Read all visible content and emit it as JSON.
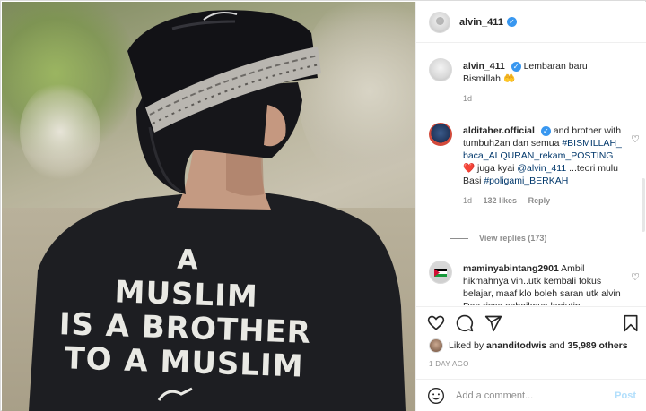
{
  "post": {
    "username": "alvin_411",
    "shirt_text": [
      "A",
      "MUSLIM",
      "IS A BROTHER",
      "TO A MUSLIM"
    ]
  },
  "caption": {
    "username": "alvin_411",
    "text": "Lembaran baru Bismillah",
    "emoji": "🤲",
    "time": "1d"
  },
  "comments": [
    {
      "username": "alditaher.official",
      "text_parts": [
        {
          "t": " and brother with tumbuh2an dan semua "
        },
        {
          "t": "#BISMILLAH_baca_ALQURAN_rekam_POSTING",
          "tag": true
        },
        {
          "t": "❤️"
        },
        {
          "t": " juga kyai "
        },
        {
          "t": "@alvin_411",
          "tag": true
        },
        {
          "t": " ...teori mulu Basi "
        },
        {
          "t": "#poligami_BERKAH",
          "tag": true
        }
      ],
      "time": "1d",
      "likes": "132 likes",
      "reply_label": "Reply",
      "view_replies": "View replies (173)"
    },
    {
      "username": "maminyabintang2901",
      "text": "Ambil hikmahnya vin..utk kembali fokus belajar, maaf klo boleh saran utk alvin Dan rissa sebaiknya lanjutin"
    }
  ],
  "likes": {
    "prefix": "Liked by ",
    "user": "ananditodwis",
    "and": " and ",
    "count": "35,989 others"
  },
  "time_ago": "1 DAY AGO",
  "add_comment": {
    "placeholder": "Add a comment...",
    "post_label": "Post"
  },
  "icons": {
    "verified": "verified-badge-icon",
    "heart": "heart-icon",
    "comment": "comment-icon",
    "share": "share-icon",
    "save": "bookmark-icon",
    "emoji": "emoji-icon"
  },
  "colors": {
    "link": "#00376b",
    "verified": "#3897f0",
    "secondary_text": "#8e8e8e",
    "post_disabled": "#b2dffc"
  }
}
